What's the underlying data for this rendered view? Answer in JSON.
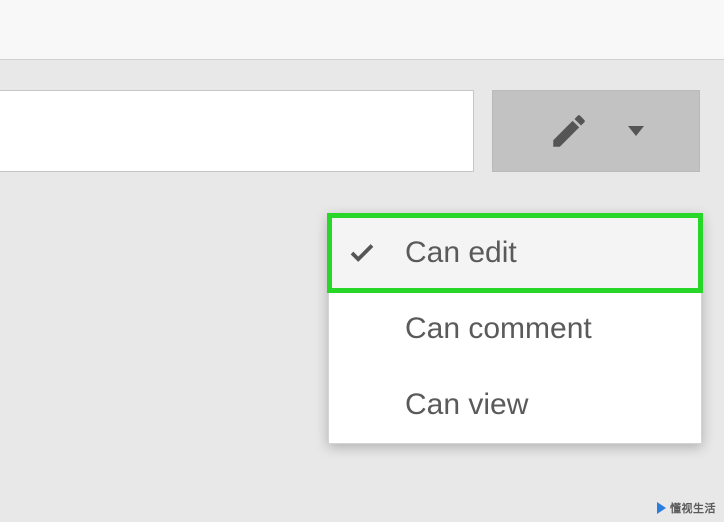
{
  "permission_button": {
    "icon": "pencil-icon"
  },
  "menu": {
    "items": [
      {
        "label": "Can edit",
        "selected": true
      },
      {
        "label": "Can comment",
        "selected": false
      },
      {
        "label": "Can view",
        "selected": false
      }
    ]
  },
  "watermark": {
    "text": "懂视生活"
  }
}
